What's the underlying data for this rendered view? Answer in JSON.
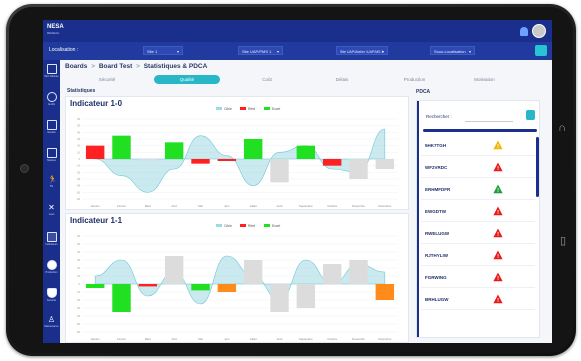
{
  "app": {
    "logo": "NESA",
    "logo_sub": "RESEAU"
  },
  "filters": {
    "label": "Localisation :",
    "selects": [
      {
        "value": "Site 1"
      },
      {
        "value": "Site UAP/PMS 1"
      },
      {
        "value": "Site UAP/Atelier /UAP/MS 1"
      },
      {
        "value": "Sous-Localisation"
      }
    ]
  },
  "sidebar": {
    "items": [
      {
        "label": "Mon Tableau"
      },
      {
        "label": "Audits"
      },
      {
        "label": "Gestion"
      },
      {
        "label": "Stations"
      },
      {
        "label": "5S"
      },
      {
        "label": "Lean"
      },
      {
        "label": "Indicateurs"
      },
      {
        "label": "Production"
      },
      {
        "label": "Sécurité"
      },
      {
        "label": "Maintenance"
      }
    ]
  },
  "breadcrumb": {
    "items": [
      "Boards",
      ">",
      "Board Test",
      ">",
      "Statistiques & PDCA"
    ]
  },
  "tabs": [
    {
      "label": "Sécurité",
      "active": false
    },
    {
      "label": "Qualité",
      "active": true
    },
    {
      "label": "Coût",
      "active": false
    },
    {
      "label": "Délais",
      "active": false
    },
    {
      "label": "Production",
      "active": false
    },
    {
      "label": "Motivation",
      "active": false
    }
  ],
  "stats": {
    "title": "Statistiques"
  },
  "charts": [
    {
      "title": "Indicateur 1-0",
      "legend": [
        "Cible",
        "Réel",
        "Ecart"
      ]
    },
    {
      "title": "Indicateur 1-1",
      "legend": [
        "Cible",
        "Réel",
        "Ecart"
      ]
    }
  ],
  "chart_data": [
    {
      "type": "bar",
      "title": "Indicateur 1-0",
      "categories": [
        "Janvier",
        "Février",
        "Mars",
        "Avril",
        "Mai",
        "Juin",
        "Juillet",
        "Août",
        "Septembre",
        "Octobre",
        "Novembre",
        "Décembre"
      ],
      "series": [
        {
          "name": "Ecart",
          "values": [
            20,
            35,
            0,
            25,
            -7,
            -3,
            30,
            -35,
            20,
            -10,
            -30,
            -15
          ],
          "colors": [
            "#ff2121",
            "#21e021",
            "#dcdcdc",
            "#21e021",
            "#ff2121",
            "#ff2121",
            "#21e021",
            "#dcdcdc",
            "#21e021",
            "#ff2121",
            "#dcdcdc",
            "#dcdcdc"
          ]
        }
      ],
      "curve_values": [
        0,
        -25,
        -50,
        -15,
        35,
        5,
        -40,
        10,
        20,
        -15,
        -20,
        45
      ],
      "ylim": [
        -60,
        60
      ]
    },
    {
      "type": "bar",
      "title": "Indicateur 1-1",
      "categories": [
        "Janvier",
        "Février",
        "Mars",
        "Avril",
        "Mai",
        "Juin",
        "Juillet",
        "Août",
        "Septembre",
        "Octobre",
        "Novembre",
        "Décembre"
      ],
      "series": [
        {
          "name": "Ecart",
          "values": [
            -5,
            -35,
            -3,
            35,
            -8,
            -10,
            30,
            -35,
            -30,
            25,
            30,
            -20
          ],
          "colors": [
            "#21e021",
            "#21e021",
            "#ff2121",
            "#dcdcdc",
            "#21e021",
            "#ff8c1a",
            "#dcdcdc",
            "#dcdcdc",
            "#dcdcdc",
            "#dcdcdc",
            "#dcdcdc",
            "#ff8c1a"
          ]
        }
      ],
      "curve_values": [
        10,
        30,
        -15,
        15,
        -25,
        35,
        10,
        -20,
        30,
        0,
        25,
        15
      ],
      "ylim": [
        -60,
        60
      ]
    }
  ],
  "pdca": {
    "title": "PDCA",
    "search_label": "Rechercher :",
    "search_placeholder": "",
    "rows": [
      {
        "code": "5HK7TGH",
        "status": "yellow"
      },
      {
        "code": "WF2VRDC",
        "status": "red"
      },
      {
        "code": "ERHMFDFR",
        "status": "green"
      },
      {
        "code": "EWGDTW",
        "status": "red"
      },
      {
        "code": "RWELUGW",
        "status": "red"
      },
      {
        "code": "RJTHYLIW",
        "status": "red"
      },
      {
        "code": "FGRWING",
        "status": "red"
      },
      {
        "code": "BRHLUGW",
        "status": "red"
      }
    ]
  },
  "colors": {
    "primary": "#1a2f8c",
    "accent": "#27b7c7",
    "red": "#ff2121",
    "green": "#21e021",
    "orange": "#ff8c1a",
    "gray": "#dcdcdc",
    "curve": "#9fd9e3"
  }
}
